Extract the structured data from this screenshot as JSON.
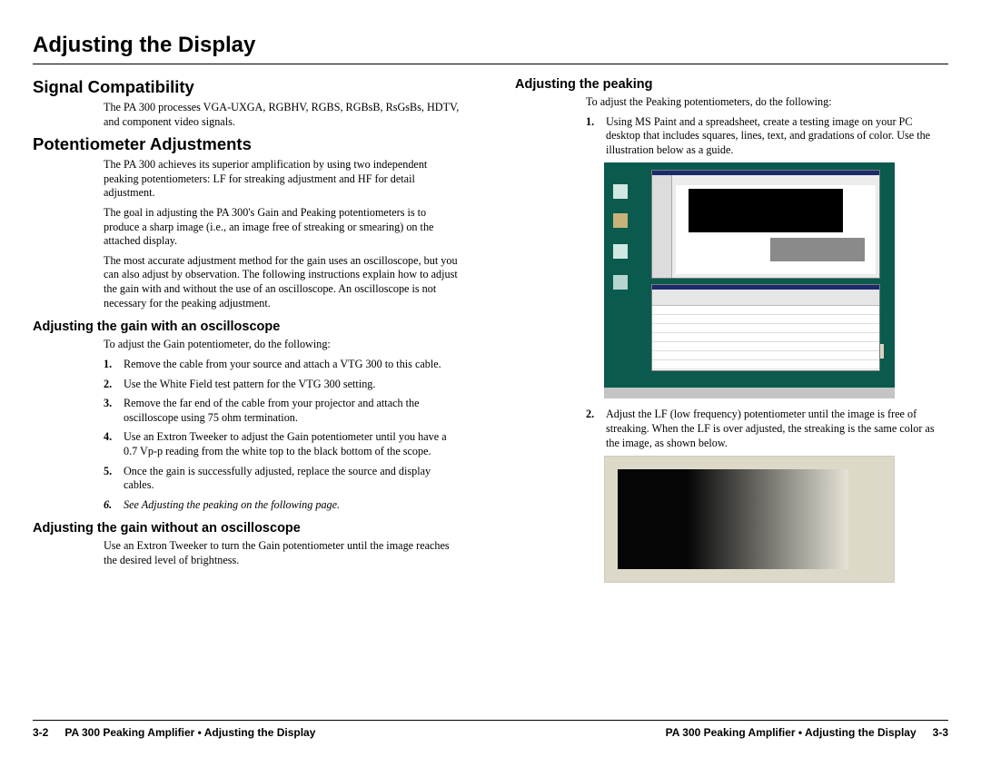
{
  "chapterTitle": "Adjusting the Display",
  "leftColumn": {
    "sectionA": {
      "heading": "Signal Compatibility",
      "p1": "The PA 300 processes VGA-UXGA, RGBHV, RGBS, RGBsB, RsGsBs, HDTV, and component video signals."
    },
    "sectionB": {
      "heading": "Potentiometer Adjustments",
      "p1": "The PA 300 achieves its superior amplification by using two independent peaking potentiometers: LF for streaking adjustment and HF for detail adjustment.",
      "p2": "The goal in adjusting the PA 300's Gain and Peaking potentiometers is to produce a sharp image (i.e., an image free of streaking or smearing) on the attached display.",
      "p3": "The most accurate adjustment method for the gain uses an oscilloscope, but you can also adjust by observation.  The following instructions explain how to adjust the gain with and without the use of an oscilloscope.  An oscilloscope is not necessary for the peaking adjustment."
    },
    "subA": {
      "heading": "Adjusting the gain with an oscilloscope",
      "intro": "To adjust the Gain potentiometer, do the following:",
      "steps": [
        "Remove the cable from your source and attach a VTG 300 to this cable.",
        "Use the White Field test pattern for the VTG 300 setting.",
        "Remove the far end of the cable from your projector and attach the oscilloscope using 75 ohm termination.",
        "Use an Extron Tweeker to adjust the Gain potentiometer until you have a 0.7 Vp-p reading from the white top to the black bottom of the scope.",
        "Once the gain is successfully adjusted, replace the source and display cables."
      ],
      "step6_pre": "See ",
      "step6_italic": "Adjusting the peaking",
      "step6_post": " on the following page."
    },
    "subB": {
      "heading": "Adjusting the gain without an oscilloscope",
      "p1": "Use an Extron Tweeker to turn the Gain potentiometer until the image reaches the desired level of brightness."
    }
  },
  "rightColumn": {
    "subC": {
      "heading": "Adjusting the peaking",
      "intro": "To adjust the Peaking potentiometers, do the following:",
      "step1": "Using MS Paint and a spreadsheet, create a testing image on your PC desktop that includes squares, lines, text, and gradations of color.  Use the illustration below as a guide.",
      "step2": "Adjust the LF (low frequency) potentiometer until the image is free of streaking.  When the LF is over adjusted, the streaking is the same color as the image, as shown below."
    }
  },
  "footer": {
    "leftNum": "3-2",
    "leftText": "PA 300 Peaking Amplifier • Adjusting the Display",
    "rightText": "PA 300 Peaking Amplifier • Adjusting the Display",
    "rightNum": "3-3"
  },
  "nums": {
    "n1": "1.",
    "n2": "2.",
    "n3": "3.",
    "n4": "4.",
    "n5": "5.",
    "n6": "6."
  }
}
